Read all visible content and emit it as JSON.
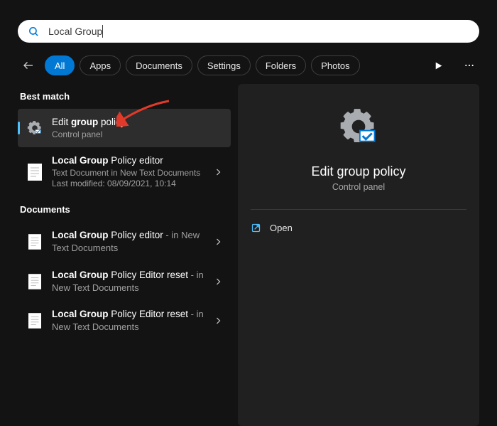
{
  "search": {
    "query": "Local Group"
  },
  "filters": {
    "items": [
      {
        "label": "All",
        "active": true
      },
      {
        "label": "Apps",
        "active": false
      },
      {
        "label": "Documents",
        "active": false
      },
      {
        "label": "Settings",
        "active": false
      },
      {
        "label": "Folders",
        "active": false
      },
      {
        "label": "Photos",
        "active": false
      }
    ]
  },
  "sections": {
    "best_match": "Best match",
    "documents": "Documents"
  },
  "best_match": {
    "item0": {
      "title_prefix": "Edit ",
      "title_bold": "group",
      "title_suffix": " policy",
      "sub": "Control panel"
    },
    "item1": {
      "title_bold": "Local Group",
      "title_suffix": " Policy editor",
      "sub1": "Text Document in New Text Documents",
      "sub2": "Last modified: 08/09/2021, 10:14"
    }
  },
  "docs": {
    "item0": {
      "title_bold": "Local Group",
      "title_suffix": " Policy editor",
      "in": " - in New Text Documents"
    },
    "item1": {
      "title_bold": "Local Group",
      "title_suffix": " Policy Editor reset",
      "in": " - in New Text Documents"
    },
    "item2": {
      "title_bold": "Local Group",
      "title_suffix": " Policy Editor reset",
      "in": " - in New Text Documents"
    }
  },
  "detail": {
    "title": "Edit group policy",
    "sub": "Control panel",
    "action_open": "Open"
  }
}
